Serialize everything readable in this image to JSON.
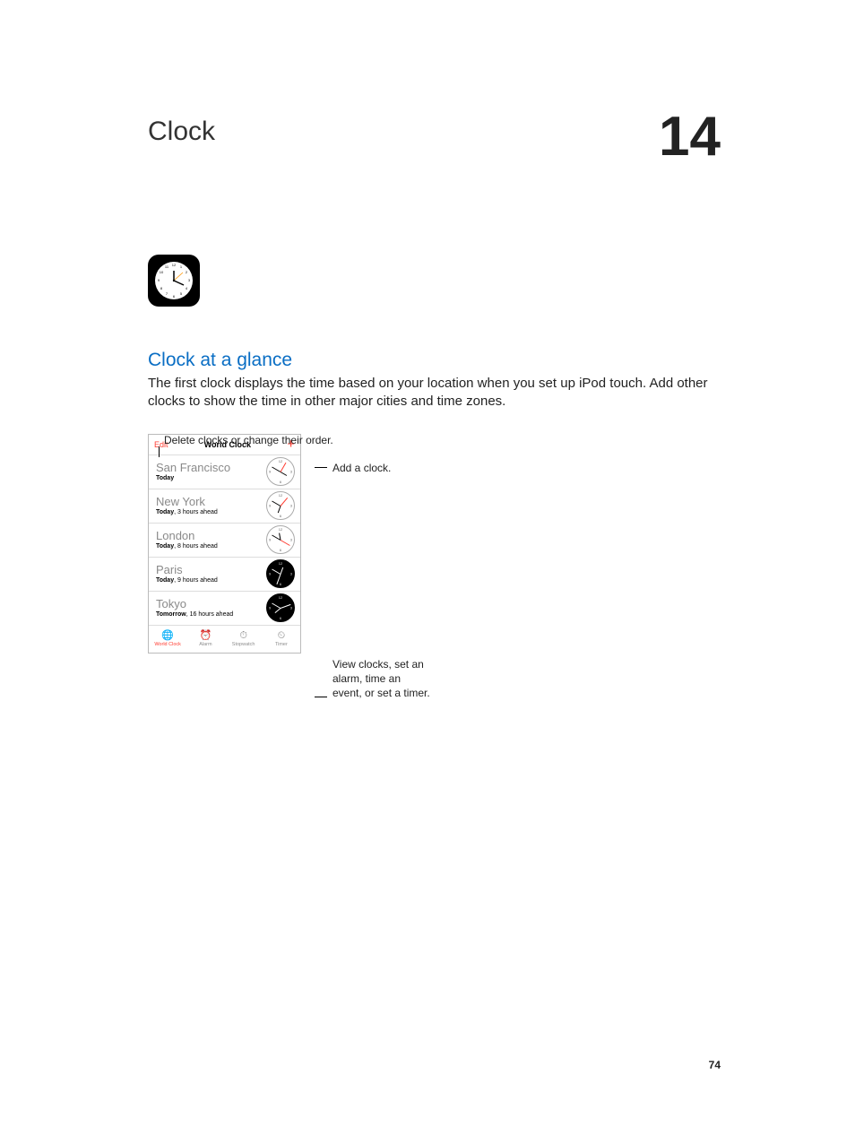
{
  "chapter": {
    "title": "Clock",
    "number": "14"
  },
  "section": {
    "subhead": "Clock at a glance",
    "body": "The first clock displays the time based on your location when you set up iPod touch. Add other clocks to show the time in other major cities and time zones."
  },
  "callouts": {
    "top": "Delete clocks or change their order.",
    "add": "Add a clock.",
    "tabs": "View clocks, set an alarm, time an event, or set a timer."
  },
  "screen": {
    "nav": {
      "edit": "Edit",
      "title": "World Clock",
      "plus": "+"
    },
    "rows": [
      {
        "city": "San Francisco",
        "day": "Today",
        "offset": "",
        "mode": "day",
        "hour": 120,
        "min": 300,
        "sec": 30
      },
      {
        "city": "New York",
        "day": "Today",
        "offset": ", 3 hours ahead",
        "mode": "day",
        "hour": 200,
        "min": 300,
        "sec": 40
      },
      {
        "city": "London",
        "day": "Today",
        "offset": ", 8 hours ahead",
        "mode": "day",
        "hour": 350,
        "min": 300,
        "sec": 120
      },
      {
        "city": "Paris",
        "day": "Today",
        "offset": ", 9 hours ahead",
        "mode": "night",
        "hour": 20,
        "min": 300,
        "sec": 200
      },
      {
        "city": "Tokyo",
        "day": "Tomorrow",
        "offset": ", 16 hours ahead",
        "mode": "night",
        "hour": 230,
        "min": 300,
        "sec": 70
      }
    ],
    "tabs": [
      {
        "label": "World Clock",
        "icon": "globe",
        "active": true
      },
      {
        "label": "Alarm",
        "icon": "alarm",
        "active": false
      },
      {
        "label": "Stopwatch",
        "icon": "stopwatch",
        "active": false
      },
      {
        "label": "Timer",
        "icon": "timer",
        "active": false
      }
    ]
  },
  "page_number": "74"
}
